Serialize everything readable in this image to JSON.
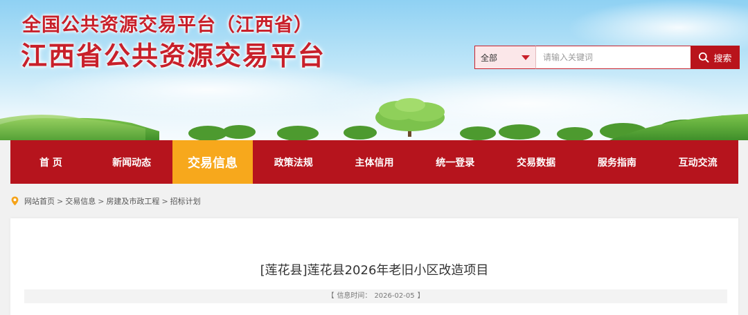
{
  "header": {
    "subtitle": "全国公共资源交易平台（江西省）",
    "title": "江西省公共资源交易平台"
  },
  "search": {
    "category": "全部",
    "placeholder": "请输入关键词",
    "button_label": "搜索"
  },
  "nav": {
    "items": [
      {
        "label": "首 页"
      },
      {
        "label": "新闻动态"
      },
      {
        "label": "交易信息"
      },
      {
        "label": "政策法规"
      },
      {
        "label": "主体信用"
      },
      {
        "label": "统一登录"
      },
      {
        "label": "交易数据"
      },
      {
        "label": "服务指南"
      },
      {
        "label": "互动交流"
      }
    ],
    "active_index": 2
  },
  "breadcrumb": {
    "items": [
      "网站首页",
      "交易信息",
      "房建及市政工程",
      "招标计划"
    ],
    "separator": ">"
  },
  "article": {
    "title": "[莲花县]莲花县2026年老旧小区改造项目",
    "meta_open": "【",
    "meta_label": "信息时间：",
    "meta_date": "2026-02-05",
    "meta_close": "】"
  },
  "colors": {
    "brand_red": "#b6141d",
    "accent_orange": "#f7a81c",
    "title_red": "#c8202a"
  }
}
